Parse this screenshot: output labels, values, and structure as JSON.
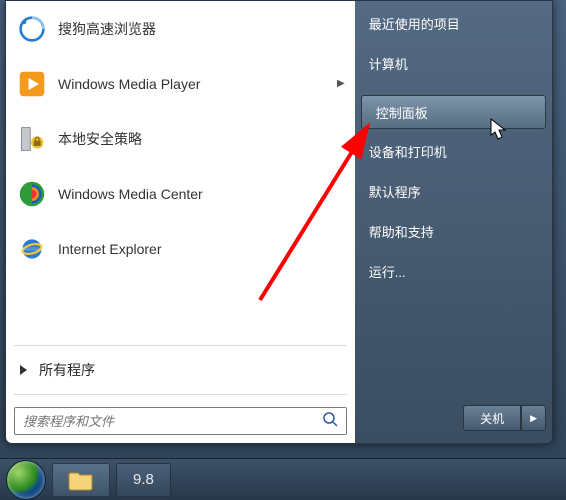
{
  "left": {
    "programs": [
      {
        "label": "搜狗高速浏览器",
        "has_submenu": false,
        "icon": "sogou"
      },
      {
        "label": "Windows Media Player",
        "has_submenu": true,
        "icon": "wmp"
      },
      {
        "label": "本地安全策略",
        "has_submenu": false,
        "icon": "secpol"
      },
      {
        "label": "Windows Media Center",
        "has_submenu": false,
        "icon": "wmc"
      },
      {
        "label": "Internet Explorer",
        "has_submenu": false,
        "icon": "ie"
      }
    ],
    "all_programs": "所有程序",
    "search_placeholder": "搜索程序和文件"
  },
  "right": {
    "items": [
      {
        "label": "最近使用的项目",
        "selected": false
      },
      {
        "label": "计算机",
        "selected": false
      },
      {
        "label": "控制面板",
        "selected": true
      },
      {
        "label": "设备和打印机",
        "selected": false
      },
      {
        "label": "默认程序",
        "selected": false
      },
      {
        "label": "帮助和支持",
        "selected": false
      },
      {
        "label": "运行...",
        "selected": false
      }
    ],
    "shutdown": "关机",
    "shutdown_arrow": "▶"
  },
  "taskbar": {
    "rating": "9.8"
  },
  "colors": {
    "accent_arrow": "#ff0000"
  }
}
